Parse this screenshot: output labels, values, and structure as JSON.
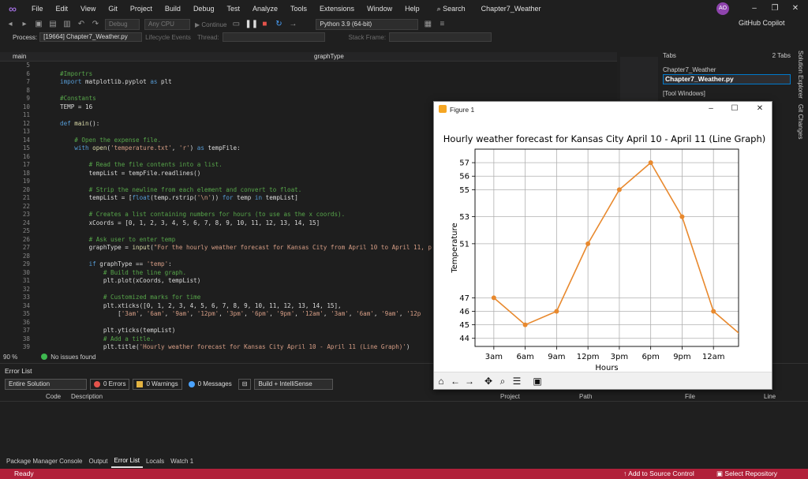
{
  "menubar": {
    "items": [
      "File",
      "Edit",
      "View",
      "Git",
      "Project",
      "Build",
      "Debug",
      "Test",
      "Analyze",
      "Tools",
      "Extensions",
      "Window",
      "Help"
    ],
    "search": "Search",
    "solution_title": "Chapter7_Weather",
    "avatar": "AO"
  },
  "toolbar": {
    "config": "Debug",
    "platform": "Any CPU",
    "continue": "Continue",
    "python_env": "Python 3.9 (64-bit)",
    "copilot": "GitHub Copilot"
  },
  "processbar": {
    "process_label": "Process:",
    "process_value": "[19664] Chapter7_Weather.py",
    "lifecycle": "Lifecycle Events",
    "thread": "Thread:",
    "stack_frame": "Stack Frame:"
  },
  "navbar": {
    "left": "main",
    "right": "graphType"
  },
  "editor": {
    "lines": [
      {
        "n": "5",
        "c": []
      },
      {
        "n": "6",
        "c": [
          [
            "cm",
            "#Importrs"
          ]
        ]
      },
      {
        "n": "7",
        "c": [
          [
            "kw",
            "import"
          ],
          [
            "tx",
            " matplotlib.pyplot "
          ],
          [
            "kw",
            "as"
          ],
          [
            "tx",
            " plt"
          ]
        ]
      },
      {
        "n": "8",
        "c": []
      },
      {
        "n": "9",
        "c": [
          [
            "cm",
            "#Constants"
          ]
        ]
      },
      {
        "n": "10",
        "c": [
          [
            "tx",
            "TEMP = 16"
          ]
        ]
      },
      {
        "n": "11",
        "c": []
      },
      {
        "n": "12",
        "c": [
          [
            "kw",
            "def"
          ],
          [
            "fn",
            " main"
          ],
          [
            "tx",
            "():"
          ]
        ]
      },
      {
        "n": "13",
        "c": []
      },
      {
        "n": "14",
        "c": [
          [
            "cm",
            "    # Open the expense file."
          ]
        ]
      },
      {
        "n": "15",
        "c": [
          [
            "kw",
            "    with"
          ],
          [
            "fn",
            " open"
          ],
          [
            "tx",
            "("
          ],
          [
            "st",
            "'temperature.txt'"
          ],
          [
            "tx",
            ", "
          ],
          [
            "st",
            "'r'"
          ],
          [
            "tx",
            ") "
          ],
          [
            "kw",
            "as"
          ],
          [
            "tx",
            " tempFile:"
          ]
        ]
      },
      {
        "n": "16",
        "c": []
      },
      {
        "n": "17",
        "c": [
          [
            "cm",
            "        # Read the file contents into a list."
          ]
        ]
      },
      {
        "n": "18",
        "c": [
          [
            "tx",
            "        tempList = tempFile.readlines()"
          ]
        ]
      },
      {
        "n": "19",
        "c": []
      },
      {
        "n": "20",
        "c": [
          [
            "cm",
            "        # Strip the newline from each element and convert to float."
          ]
        ]
      },
      {
        "n": "21",
        "c": [
          [
            "tx",
            "        tempList = ["
          ],
          [
            "kw",
            "float"
          ],
          [
            "tx",
            "(temp.rstrip("
          ],
          [
            "st",
            "'\\n'"
          ],
          [
            "tx",
            ")) "
          ],
          [
            "kw",
            "for"
          ],
          [
            "tx",
            " temp "
          ],
          [
            "kw",
            "in"
          ],
          [
            "tx",
            " tempList]"
          ]
        ]
      },
      {
        "n": "22",
        "c": []
      },
      {
        "n": "23",
        "c": [
          [
            "cm",
            "        # Creates a list containing numbers for hours (to use as the x coords)."
          ]
        ]
      },
      {
        "n": "24",
        "c": [
          [
            "tx",
            "        xCoords = [0, 1, 2, 3, 4, 5, 6, 7, 8, 9, 10, 11, 12, 13, 14, 15]"
          ]
        ]
      },
      {
        "n": "25",
        "c": []
      },
      {
        "n": "26",
        "c": [
          [
            "cm",
            "        # Ask user to enter temp"
          ]
        ]
      },
      {
        "n": "27",
        "c": [
          [
            "tx",
            "        graphType = "
          ],
          [
            "fn",
            "input"
          ],
          [
            "tx",
            "("
          ],
          [
            "st",
            "\"For the hourly weather forecast for Kansas City from April 10 to April 11, p"
          ]
        ]
      },
      {
        "n": "28",
        "c": []
      },
      {
        "n": "29",
        "c": [
          [
            "kw",
            "        if"
          ],
          [
            "tx",
            " graphType == "
          ],
          [
            "st",
            "'temp'"
          ],
          [
            "tx",
            ":"
          ]
        ]
      },
      {
        "n": "30",
        "c": [
          [
            "cm",
            "            # Build the line graph."
          ]
        ]
      },
      {
        "n": "31",
        "c": [
          [
            "tx",
            "            plt.plot(xCoords, tempList)"
          ]
        ]
      },
      {
        "n": "32",
        "c": []
      },
      {
        "n": "33",
        "c": [
          [
            "cm",
            "            # Customized marks for time"
          ]
        ]
      },
      {
        "n": "34",
        "c": [
          [
            "tx",
            "            plt.xticks([0, 1, 2, 3, 4, 5, 6, 7, 8, 9, 10, 11, 12, 13, 14, 15],"
          ]
        ]
      },
      {
        "n": "35",
        "c": [
          [
            "tx",
            "                ["
          ],
          [
            "st",
            "'3am'"
          ],
          [
            "tx",
            ", "
          ],
          [
            "st",
            "'6am'"
          ],
          [
            "tx",
            ", "
          ],
          [
            "st",
            "'9am'"
          ],
          [
            "tx",
            ", "
          ],
          [
            "st",
            "'12pm'"
          ],
          [
            "tx",
            ", "
          ],
          [
            "st",
            "'3pm'"
          ],
          [
            "tx",
            ", "
          ],
          [
            "st",
            "'6pm'"
          ],
          [
            "tx",
            ", "
          ],
          [
            "st",
            "'9pm'"
          ],
          [
            "tx",
            ", "
          ],
          [
            "st",
            "'12am'"
          ],
          [
            "tx",
            ", "
          ],
          [
            "st",
            "'3am'"
          ],
          [
            "tx",
            ", "
          ],
          [
            "st",
            "'6am'"
          ],
          [
            "tx",
            ", "
          ],
          [
            "st",
            "'9am'"
          ],
          [
            "tx",
            ", "
          ],
          [
            "st",
            "'12p"
          ]
        ]
      },
      {
        "n": "36",
        "c": []
      },
      {
        "n": "37",
        "c": [
          [
            "tx",
            "            plt.yticks(tempList)"
          ]
        ]
      },
      {
        "n": "38",
        "c": [
          [
            "cm",
            "            # Add a title."
          ]
        ]
      },
      {
        "n": "39",
        "c": [
          [
            "tx",
            "            plt.title("
          ],
          [
            "st",
            "'Hourly weather forecast for Kansas City April 10 - April 11 (Line Graph)'"
          ],
          [
            "tx",
            ")"
          ]
        ]
      },
      {
        "n": "40",
        "c": []
      }
    ]
  },
  "editor_status": {
    "zoom": "90 %",
    "issues": "No issues found"
  },
  "tabs_panel": {
    "title": "Tabs",
    "count": "2 Tabs",
    "group": "Chapter7_Weather",
    "active": "Chapter7_Weather.py",
    "tool_windows": "[Tool Windows]"
  },
  "side_labels": [
    "Solution Explorer",
    "Git Changes"
  ],
  "error_list": {
    "title": "Error List",
    "scope": "Entire Solution",
    "errors": "0 Errors",
    "warnings": "0 Warnings",
    "messages": "0 Messages",
    "build": "Build + IntelliSense",
    "columns": [
      "Code",
      "Description",
      "Project",
      "Path",
      "File",
      "Line"
    ]
  },
  "bottom_tabs": [
    "Package Manager Console",
    "Output",
    "Error List",
    "Locals",
    "Watch 1"
  ],
  "statusbar": {
    "ready": "Ready",
    "source_control": "Add to Source Control",
    "repo": "Select Repository"
  },
  "figure": {
    "window_title": "Figure 1",
    "toolbar_icons": [
      "home-icon",
      "back-icon",
      "forward-icon",
      "pan-icon",
      "zoom-icon",
      "configure-icon",
      "save-icon"
    ]
  },
  "chart_data": {
    "type": "line",
    "title": "Hourly weather forecast for Kansas City April 10 - April 11 (Line Graph)",
    "xlabel": "Hours",
    "ylabel": "Temperature",
    "x": [
      0,
      1,
      2,
      3,
      4,
      5,
      6,
      7,
      8
    ],
    "tick_labels": [
      "3am",
      "6am",
      "9am",
      "12pm",
      "3pm",
      "6pm",
      "9pm",
      "12am"
    ],
    "values": [
      47,
      45,
      46,
      51,
      55,
      57,
      53,
      46,
      44
    ],
    "yticks": [
      44,
      45,
      46,
      47,
      51,
      53,
      55,
      56,
      57
    ],
    "xlim": [
      -0.6,
      7.8
    ],
    "ylim": [
      43.4,
      58.0
    ],
    "grid": true,
    "color": "#e8892e"
  }
}
